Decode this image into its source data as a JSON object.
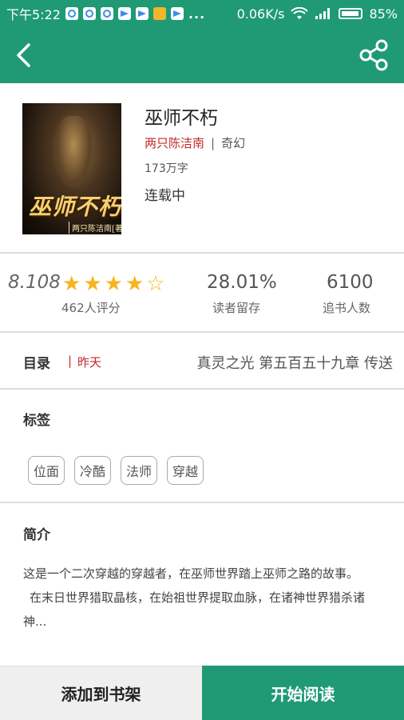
{
  "status_bar": {
    "time": "下午5:22",
    "dots": "...",
    "network_speed": "0.06K/s",
    "battery": "85%"
  },
  "nav": {
    "back_icon": "chevron-left-icon",
    "share_icon": "share-icon"
  },
  "book": {
    "title": "巫师不朽",
    "author": "两只陈洁南",
    "separator": "|",
    "genre": "奇幻",
    "word_count": "173万字",
    "status": "连载中",
    "cover_title": "巫师不朽",
    "cover_author": "两只陈洁南[著]"
  },
  "stats": {
    "rating": "8.108",
    "stars_filled": 4,
    "stars_total": 5,
    "rating_count_label": "462人评分",
    "retention_value": "28.01%",
    "retention_label": "读者留存",
    "followers_value": "6100",
    "followers_label": "追书人数"
  },
  "toc": {
    "label": "目录",
    "separator": "|",
    "updated": "昨天",
    "latest_chapter": "真灵之光 第五百五十九章 传送"
  },
  "tags": {
    "title": "标签",
    "items": [
      "位面",
      "冷酷",
      "法师",
      "穿越"
    ]
  },
  "intro": {
    "title": "简介",
    "paragraph1": "这是一个二次穿越的穿越者，在巫师世界踏上巫师之路的故事。",
    "paragraph2": "在末日世界猎取晶核，在始祖世界提取血脉，在诸神世界猎杀诸神..."
  },
  "actions": {
    "add_to_shelf": "添加到书架",
    "start_reading": "开始阅读"
  },
  "colors": {
    "primary": "#1f9a74",
    "author_red": "#c62828",
    "star": "#f6b51e"
  }
}
